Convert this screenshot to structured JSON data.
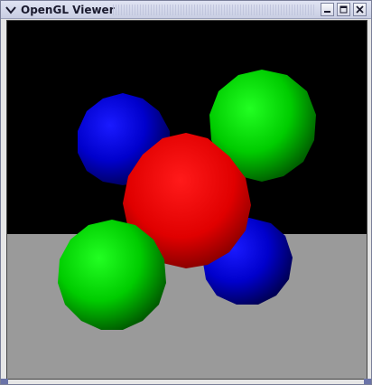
{
  "window": {
    "title": "OpenGL Viewer",
    "icons": {
      "menu": "chevron-down-icon",
      "minimize": "minimize-icon",
      "maximize": "maximize-icon",
      "close": "close-icon"
    }
  },
  "scene": {
    "background_color": "#000000",
    "floor_color": "#9a9a9a",
    "objects": [
      {
        "name": "blue-sphere-back",
        "color": "blue"
      },
      {
        "name": "green-sphere-top-right",
        "color": "green"
      },
      {
        "name": "red-sphere-center",
        "color": "red"
      },
      {
        "name": "blue-sphere-front-right",
        "color": "blue"
      },
      {
        "name": "green-sphere-front-left",
        "color": "green"
      }
    ]
  }
}
